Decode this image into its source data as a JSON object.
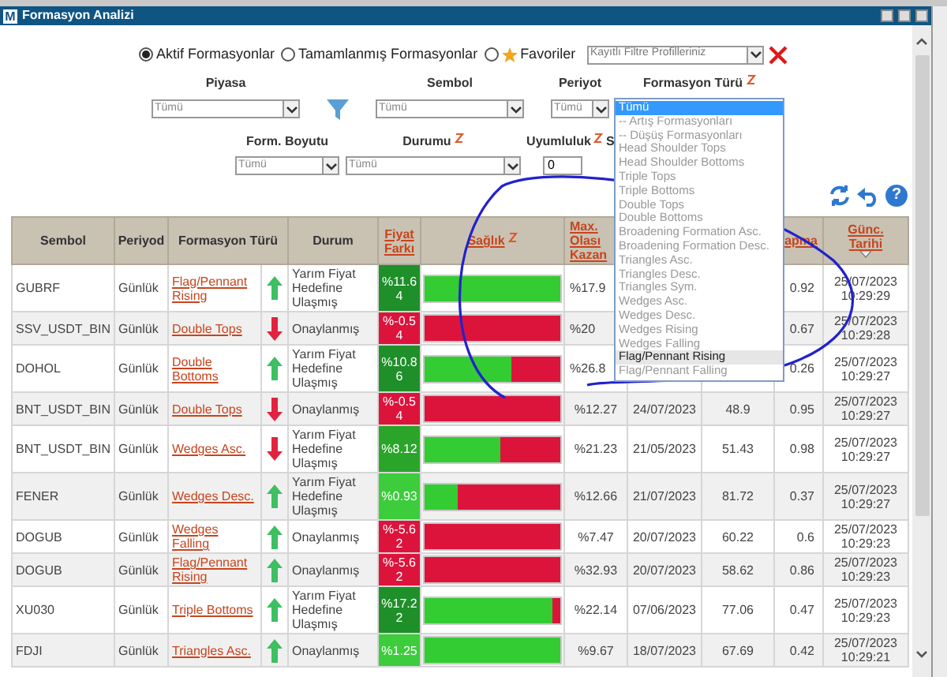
{
  "window": {
    "logo": "M",
    "title": "Formasyon Analizi"
  },
  "view_options": [
    {
      "label": "Aktif Formasyonlar",
      "selected": true,
      "kind": "plain"
    },
    {
      "label": "Tamamlanmış Formasyonlar",
      "selected": false,
      "kind": "plain"
    },
    {
      "label": "Favoriler",
      "selected": false,
      "kind": "favorite"
    }
  ],
  "profile_select": {
    "placeholder": "Kayıtlı Filtre Profilleriniz"
  },
  "filters": [
    {
      "label": "Piyasa",
      "value": "Tümü",
      "kind": "select"
    },
    {
      "label": "Sembol",
      "value": "Tümü",
      "kind": "select"
    },
    {
      "label": "Periyot",
      "value": "Tümü",
      "kind": "select"
    },
    {
      "label": "Formasyon Türü",
      "kind": "listbox",
      "sortable": true
    },
    {
      "label": "Form. Boyutu",
      "value": "Tümü",
      "kind": "select"
    },
    {
      "label": "Durumu",
      "value": "Tümü",
      "kind": "select",
      "sortable": true
    },
    {
      "label": "Uyumluluk",
      "value": "0",
      "kind": "input",
      "sortable": true
    },
    {
      "label": "S",
      "kind": "label"
    }
  ],
  "listbox_options": [
    {
      "label": "Tümü",
      "selected": true,
      "hovered": false
    },
    {
      "label": "-- Artış Formasyonları",
      "selected": false,
      "hovered": false
    },
    {
      "label": "-- Düşüş Formasyonları",
      "selected": false,
      "hovered": false
    },
    {
      "label": "Head Shoulder Tops",
      "selected": false,
      "hovered": false
    },
    {
      "label": "Head Shoulder Bottoms",
      "selected": false,
      "hovered": false
    },
    {
      "label": "Triple Tops",
      "selected": false,
      "hovered": false
    },
    {
      "label": "Triple Bottoms",
      "selected": false,
      "hovered": false
    },
    {
      "label": "Double Tops",
      "selected": false,
      "hovered": false
    },
    {
      "label": "Double Bottoms",
      "selected": false,
      "hovered": false
    },
    {
      "label": "Broadening Formation Asc.",
      "selected": false,
      "hovered": false
    },
    {
      "label": "Broadening Formation Desc.",
      "selected": false,
      "hovered": false
    },
    {
      "label": "Triangles Asc.",
      "selected": false,
      "hovered": false
    },
    {
      "label": "Triangles Desc.",
      "selected": false,
      "hovered": false
    },
    {
      "label": "Triangles Sym.",
      "selected": false,
      "hovered": false
    },
    {
      "label": "Wedges Asc.",
      "selected": false,
      "hovered": false
    },
    {
      "label": "Wedges Desc.",
      "selected": false,
      "hovered": false
    },
    {
      "label": "Wedges Rising",
      "selected": false,
      "hovered": false
    },
    {
      "label": "Wedges Falling",
      "selected": false,
      "hovered": false
    },
    {
      "label": "Flag/Pennant Rising",
      "selected": false,
      "hovered": true
    },
    {
      "label": "Flag/Pennant Falling",
      "selected": false,
      "hovered": false
    }
  ],
  "help_button": "?",
  "table": {
    "columns": [
      {
        "label": "Sembol",
        "kind": "plain"
      },
      {
        "label": "Periyod",
        "kind": "plain"
      },
      {
        "label": "Formasyon Türü",
        "kind": "plain"
      },
      {
        "label": "Durum",
        "kind": "plain"
      },
      {
        "label": "Fiyat Farkı",
        "kind": "link"
      },
      {
        "label": "Sağlık",
        "kind": "link",
        "sortable": true
      },
      {
        "label": "Max. Olası Kazan",
        "kind": "link"
      },
      {
        "label": "apma",
        "kind": "link"
      },
      {
        "label": "Günc. Tarihi",
        "kind": "link",
        "sorted": true
      }
    ],
    "rows": [
      {
        "symbol": "GUBRF",
        "period": "Günlük",
        "formation": "Flag/Pennant Rising",
        "rising": true,
        "status": "Yarım Fiyat Hedefine Ulaşmış",
        "price_diff": "%11.64",
        "color": "#1f8f2a",
        "level": 1,
        "max_gain": "%17.9",
        "deviation": "0.92",
        "updated": "25/07/2023 10:29:29"
      },
      {
        "symbol": "SSV_USDT_BIN",
        "period": "Günlük",
        "formation": "Double Tops",
        "rising": false,
        "status": "Onaylanmış",
        "price_diff": "%-0.54",
        "color": "#dc143c",
        "level": 0,
        "max_gain": "%20",
        "deviation": "0.67",
        "updated": "25/07/2023 10:29:28"
      },
      {
        "symbol": "DOHOL",
        "period": "Günlük",
        "formation": "Double Bottoms",
        "rising": true,
        "status": "Yarım Fiyat Hedefine Ulaşmış",
        "price_diff": "%10.86",
        "color": "#1f8f2a",
        "level": 0.64,
        "max_gain": "%26.8",
        "deviation": "0.26",
        "updated": "25/07/2023 10:29:27"
      },
      {
        "symbol": "BNT_USDT_BIN",
        "period": "Günlük",
        "formation": "Double Tops",
        "rising": false,
        "status": "Onaylanmış",
        "price_diff": "%-0.54",
        "color": "#dc143c",
        "level": 0,
        "max_gain": "%12.27",
        "date": "24/07/2023",
        "value": "48.9",
        "deviation": "0.95",
        "updated": "25/07/2023 10:29:27"
      },
      {
        "symbol": "BNT_USDT_BIN",
        "period": "Günlük",
        "formation": "Wedges Asc.",
        "rising": false,
        "status": "Yarım Fiyat Hedefine Ulaşmış",
        "price_diff": "%8.12",
        "color": "#2aa52a",
        "level": 0.56,
        "max_gain": "%21.23",
        "date": "21/05/2023",
        "value": "51.43",
        "deviation": "0.98",
        "updated": "25/07/2023 10:29:27"
      },
      {
        "symbol": "FENER",
        "period": "Günlük",
        "formation": "Wedges Desc.",
        "rising": true,
        "status": "Yarım Fiyat Hedefine Ulaşmış",
        "price_diff": "%0.93",
        "color": "#3ccc3c",
        "level": 0.24,
        "max_gain": "%12.66",
        "date": "21/07/2023",
        "value": "81.72",
        "deviation": "0.37",
        "updated": "25/07/2023 10:29:27"
      },
      {
        "symbol": "DOGUB",
        "period": "Günlük",
        "formation": "Wedges Falling",
        "rising": true,
        "status": "Onaylanmış",
        "price_diff": "%-5.62",
        "color": "#dc143c",
        "level": 0,
        "max_gain": "%7.47",
        "date": "20/07/2023",
        "value": "60.22",
        "deviation": "0.6",
        "updated": "25/07/2023 10:29:23"
      },
      {
        "symbol": "DOGUB",
        "period": "Günlük",
        "formation": "Flag/Pennant Rising",
        "rising": true,
        "status": "Onaylanmış",
        "price_diff": "%-5.62",
        "color": "#dc143c",
        "level": 0,
        "max_gain": "%32.93",
        "date": "20/07/2023",
        "value": "58.62",
        "deviation": "0.86",
        "updated": "25/07/2023 10:29:23"
      },
      {
        "symbol": "XU030",
        "period": "Günlük",
        "formation": "Triple Bottoms",
        "rising": true,
        "status": "Yarım Fiyat Hedefine Ulaşmış",
        "price_diff": "%17.22",
        "color": "#1f8f2a",
        "level": 0.94,
        "max_gain": "%22.14",
        "date": "07/06/2023",
        "value": "77.06",
        "deviation": "0.47",
        "updated": "25/07/2023 10:29:23"
      },
      {
        "symbol": "FDJI",
        "period": "Günlük",
        "formation": "Triangles Asc.",
        "rising": true,
        "status": "Onaylanmış",
        "price_diff": "%1.25",
        "color": "#3ccc3c",
        "level": 1,
        "max_gain": "%9.67",
        "date": "18/07/2023",
        "value": "67.69",
        "deviation": "0.42",
        "updated": "25/07/2023 10:29:21"
      }
    ]
  }
}
